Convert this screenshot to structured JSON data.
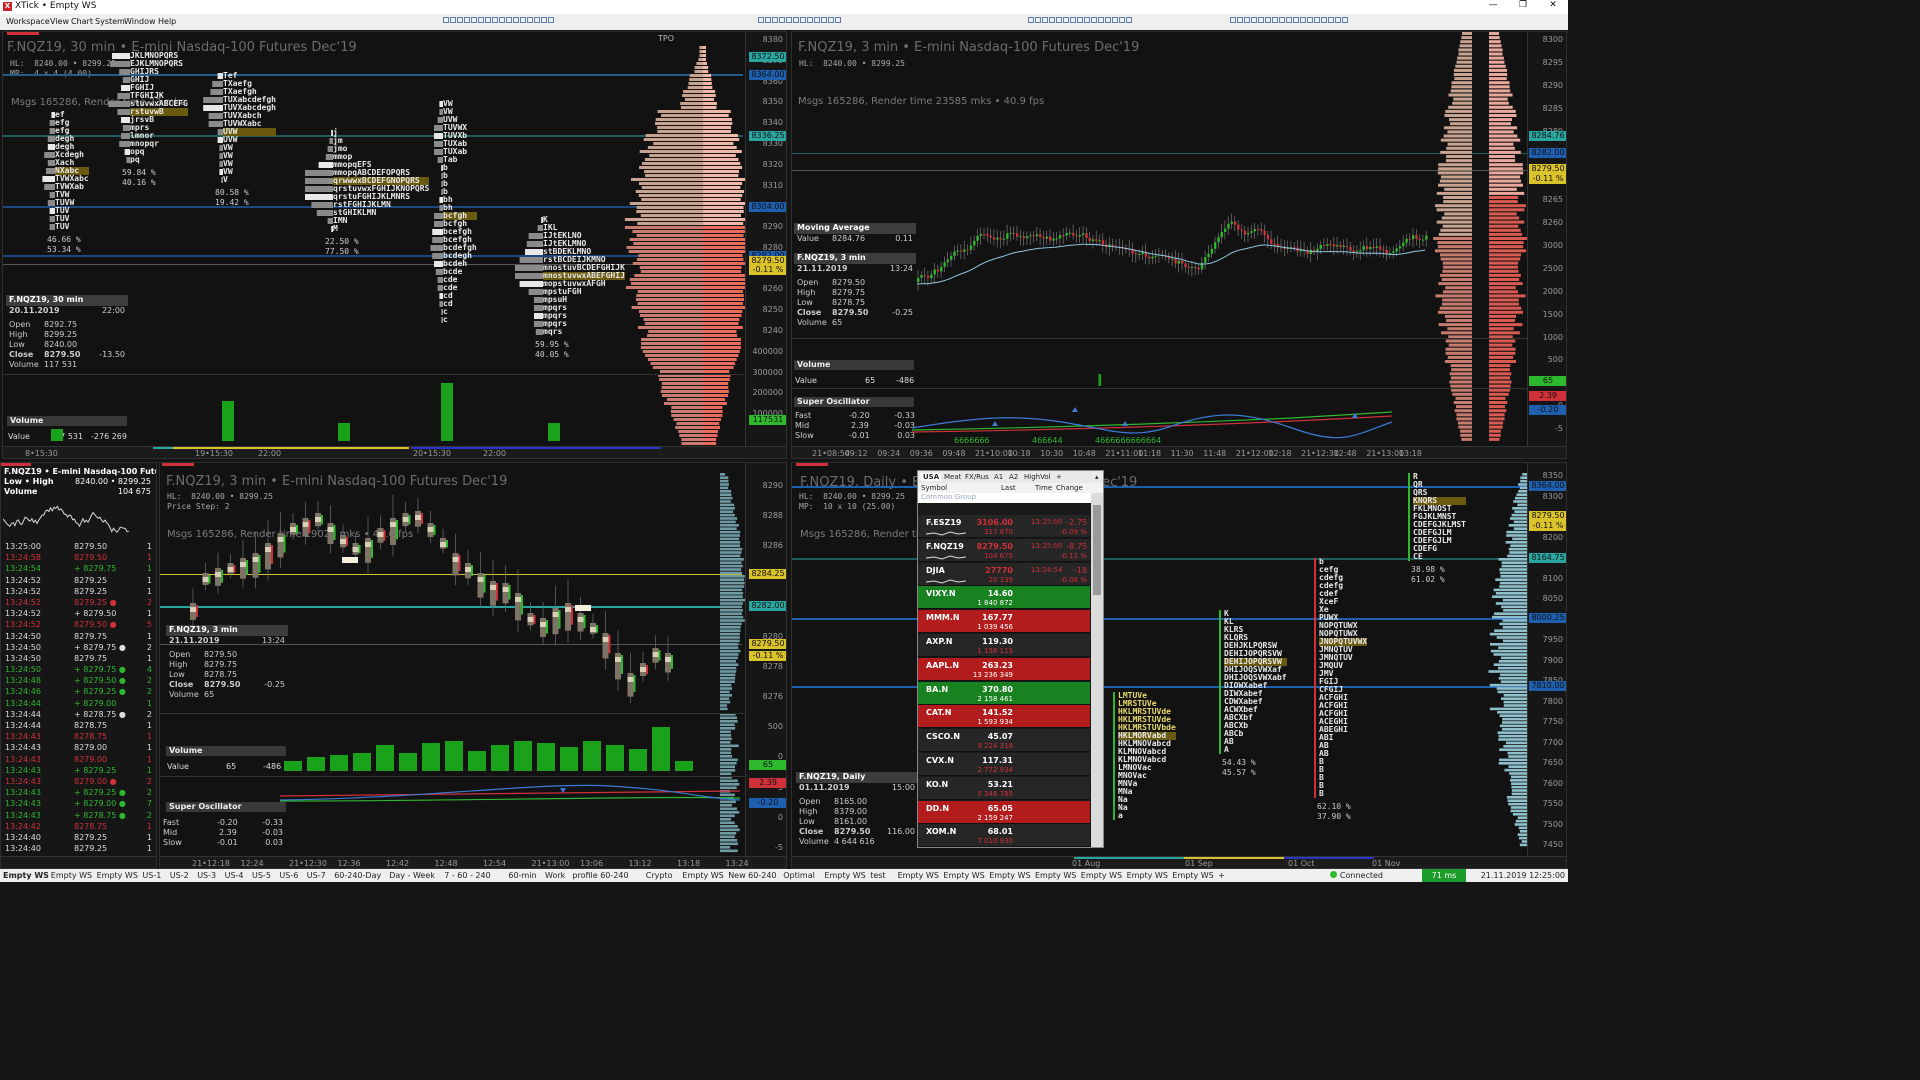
{
  "app": {
    "title": "XTick • Empty WS",
    "logo": "X",
    "window_controls": [
      "—",
      "❐",
      "✕"
    ]
  },
  "menu": [
    "Workspace",
    "View",
    "Chart",
    "System",
    "Window",
    "Help"
  ],
  "colors": {
    "bg": "#121212",
    "up": "#2eb82e",
    "down": "#d0303a",
    "blue": "#1f5fb0",
    "cyan": "#2aa6a0",
    "yellow": "#d9c22a",
    "salmon": "#e07a6e"
  },
  "pane_tl": {
    "title": "F.NQZ19, 30 min • E-mini Nasdaq-100 Futures Dec'19",
    "hl": "HL:  8240.00 • 8299.25",
    "mp": "MP:  4 x 4 (4.00)",
    "msgs": "Msgs 165286, Render time 23 mks",
    "tpo_label": "TPO",
    "axis": [
      "8380",
      "8370",
      "8360",
      "8350",
      "8340",
      "8330",
      "8320",
      "8310",
      "8300",
      "8290",
      "8280",
      "8270",
      "8260",
      "8250",
      "8240",
      "400000",
      "300000",
      "200000",
      "100000"
    ],
    "tags": [
      {
        "text": "8372.50",
        "c": "#2aa6a0"
      },
      {
        "text": "8364.00",
        "c": "#1f5fb0"
      },
      {
        "text": "8336.25",
        "c": "#2aa6a0"
      },
      {
        "text": "8304.00",
        "c": "#1f5fb0"
      },
      {
        "text": "8282.00",
        "c": "#1f5fb0"
      },
      {
        "text": "8279.50",
        "c": "#d9c22a"
      },
      {
        "text": "-0.11 %",
        "c": "#d9c22a"
      },
      {
        "text": "117531",
        "c": "#2eb82e"
      }
    ],
    "info": {
      "head": "F.NQZ19, 30 min",
      "date": "20.11.2019",
      "time": "22:00",
      "open": "8292.75",
      "high": "8299.25",
      "low": "8240.00",
      "close": "8279.50",
      "chg": "-13.50",
      "volume": "117 531"
    },
    "labels": {
      "open": "Open",
      "high": "High",
      "low": "Low",
      "close": "Close",
      "volume": "Volume"
    },
    "vol": {
      "title": "Volume",
      "label": "Value",
      "v1": "117 531",
      "v2": "-276 269"
    },
    "times": [
      "8•15:30",
      "19•15:30",
      "22:00",
      "20•15:30",
      "22:00"
    ],
    "profiles": [
      {
        "lines": [
          "ef",
          "efg",
          "efg",
          "degh",
          "degh",
          "Xcdegh",
          "Xach",
          "NXabc",
          "TVWXabc",
          "TVWXab",
          "TVW",
          "TUVW",
          "TUV",
          "TUV",
          "TUV"
        ],
        "p1": "46.66 %",
        "p2": "53.34 %"
      },
      {
        "lines": [
          "JKLMNOPQRS",
          "EJKLMNOPQRS",
          "GHIJRS",
          "GHIJ",
          "FGHIJ",
          "TFGHIJK",
          "stuvwxABCEFG",
          "rstuvwB",
          "jrsvB",
          "mprs",
          "lmnor",
          "mnopqr",
          "opq",
          "pq"
        ],
        "p1": "59.84 %",
        "p2": "40.16 %"
      },
      {
        "lines": [
          "Tef",
          "TXaefg",
          "TXaefgh",
          "TUXabcdefgh",
          "TUVXabcdegh",
          "TUVXabch",
          "TUVWXabc",
          "UVW",
          "UVW",
          "VW",
          "VW",
          "VW",
          "VW",
          "V"
        ],
        "p1": "80.58 %",
        "p2": "19.42 %"
      },
      {
        "lines": [
          "j",
          "jm",
          "jmo",
          "mmop",
          "mmopqEFS",
          "mmopqABCDEFOPQRS",
          "qrwwwxBCDEFGNOPQRS",
          "qrstuvwxFGHIJKNOPQRS",
          "qrstuFGHIJKLMNRS",
          "rstFGHIJKLMN",
          "stGHIKLMN",
          "IMN",
          "M"
        ],
        "p1": "22.50 %",
        "p2": "77.50 %"
      },
      {
        "lines": [
          "VW",
          "VW",
          "UVW",
          "TUVWX",
          "TUVXb",
          "TUXab",
          "TUXab",
          "Tab",
          "b",
          "b",
          "b",
          "b",
          "bh",
          "bh",
          "bcfgh",
          "bcfgh",
          "bcefgh",
          "bcefgh",
          "bcdefgh",
          "bcdegh",
          "bcdeh",
          "bcde",
          "cde",
          "cde",
          "cd",
          "cd",
          "c",
          "c"
        ],
        "p1": "",
        "p2": ""
      },
      {
        "lines": [
          "K",
          "IKL",
          "IJtEKLNO",
          "IJtEKLMNO",
          "stBDEKLMNO",
          "rstBCDEIJKMNO",
          "mnostuvBCDEFGHIJK",
          "mnostuvwxABEFGHIJ",
          "mopstuvwxAFGH",
          "mpstuFGH",
          "mpsuH",
          "mpqrs",
          "mpqrs",
          "mpqrs",
          "mqrs"
        ],
        "p1": "59.95 %",
        "p2": "40.05 %"
      }
    ]
  },
  "pane_tr": {
    "title": "F.NQZ19, 3 min • E-mini Nasdaq-100 Futures Dec'19",
    "hl": "HL:  8240.00 • 8299.25",
    "msgs": "Msgs 165286, Render time 23585 mks • 40.9 fps",
    "axis": [
      "8300",
      "8295",
      "8290",
      "8285",
      "8280",
      "8275",
      "8270",
      "8265",
      "8260",
      "3000",
      "2500",
      "2000",
      "1500",
      "1000",
      "500",
      "5",
      "0",
      "-5"
    ],
    "tags": [
      {
        "text": "8284.76",
        "c": "#2aa6a0"
      },
      {
        "text": "8282.00",
        "c": "#1f5fb0"
      },
      {
        "text": "8279.50",
        "c": "#d9c22a"
      },
      {
        "text": "-0.11 %",
        "c": "#d9c22a"
      },
      {
        "text": "65",
        "c": "#2eb82e"
      },
      {
        "text": "2.39",
        "c": "#d0303a"
      },
      {
        "text": "-0.20",
        "c": "#1f5fb0"
      }
    ],
    "ma": {
      "title": "Moving Average",
      "label": "Value",
      "v": "8284.76",
      "v2": "0.11"
    },
    "info": {
      "head": "F.NQZ19, 3 min",
      "date": "21.11.2019",
      "time": "13:24",
      "open": "8279.50",
      "high": "8279.75",
      "low": "8278.75",
      "close": "8279.50",
      "chg": "-0.25",
      "volume": "65"
    },
    "vol": {
      "title": "Volume",
      "label": "Value",
      "v1": "65",
      "v2": "-486"
    },
    "osc": {
      "title": "Super Oscillator",
      "fast": "Fast",
      "mid": "Mid",
      "slow": "Slow",
      "f1": "-0.20",
      "f2": "-0.33",
      "m1": "2.39",
      "m2": "-0.03",
      "s1": "-0.01",
      "s2": "0.03"
    },
    "osc_digits": [
      "6666666",
      "466644",
      "4666666666664"
    ],
    "times": [
      "21•08:54",
      "09:12",
      "09:24",
      "09:36",
      "09:48",
      "21•10:00",
      "10:18",
      "10:30",
      "10:48",
      "21•11:00",
      "11:18",
      "11:30",
      "11:48",
      "21•12:00",
      "12:18",
      "21•12:30",
      "12:48",
      "21•13:00",
      "13:18"
    ]
  },
  "ticks": {
    "head1": "F.NQZ19 • E-mini Nasdaq-100 Futures",
    "head2": "Low • High",
    "head2v": "8240.00 • 8299.25",
    "head3": "Volume",
    "head3v": "104 675",
    "rows": [
      {
        "t": "13:25:00",
        "p": "8279.50",
        "q": "1",
        "c": "#dddddd"
      },
      {
        "t": "13:24:58",
        "p": "8279.50",
        "q": "1",
        "c": "#d0303a"
      },
      {
        "t": "13:24:54",
        "p": "+ 8279.75",
        "q": "1",
        "c": "#2eb82e"
      },
      {
        "t": "13:24:52",
        "p": "8279.25",
        "q": "1",
        "c": "#dddddd"
      },
      {
        "t": "13:24:52",
        "p": "8279.25",
        "q": "1",
        "c": "#dddddd"
      },
      {
        "t": "13:24:52",
        "p": "8279.25 ●",
        "q": "2",
        "c": "#d0303a"
      },
      {
        "t": "13:24:52",
        "p": "+ 8279.50",
        "q": "1",
        "c": "#dddddd"
      },
      {
        "t": "13:24:52",
        "p": "8279.50 ●",
        "q": "5",
        "c": "#d0303a"
      },
      {
        "t": "13:24:50",
        "p": "8279.75",
        "q": "1",
        "c": "#dddddd"
      },
      {
        "t": "13:24:50",
        "p": "+ 8279.75 ●",
        "q": "2",
        "c": "#dddddd"
      },
      {
        "t": "13:24:50",
        "p": "8279.75",
        "q": "1",
        "c": "#dddddd"
      },
      {
        "t": "13:24:50",
        "p": "+ 8279.75 ●",
        "q": "4",
        "c": "#2eb82e"
      },
      {
        "t": "13:24:48",
        "p": "+ 8279.50 ●",
        "q": "2",
        "c": "#2eb82e"
      },
      {
        "t": "13:24:46",
        "p": "+ 8279.25 ●",
        "q": "2",
        "c": "#2eb82e"
      },
      {
        "t": "13:24:44",
        "p": "+ 8279.00",
        "q": "1",
        "c": "#2eb82e"
      },
      {
        "t": "13:24:44",
        "p": "+ 8278.75 ●",
        "q": "2",
        "c": "#dddddd"
      },
      {
        "t": "13:24:44",
        "p": "8278.75",
        "q": "1",
        "c": "#dddddd"
      },
      {
        "t": "13:24:43",
        "p": "8278.75",
        "q": "1",
        "c": "#d0303a"
      },
      {
        "t": "13:24:43",
        "p": "8279.00",
        "q": "1",
        "c": "#dddddd"
      },
      {
        "t": "13:24:43",
        "p": "8279.00",
        "q": "1",
        "c": "#d0303a"
      },
      {
        "t": "13:24:43",
        "p": "+ 8279.25",
        "q": "1",
        "c": "#2eb82e"
      },
      {
        "t": "13:24:43",
        "p": "8279.00 ●",
        "q": "2",
        "c": "#d0303a"
      },
      {
        "t": "13:24:43",
        "p": "+ 8279.25 ●",
        "q": "2",
        "c": "#2eb82e"
      },
      {
        "t": "13:24:43",
        "p": "+ 8279.00 ●",
        "q": "7",
        "c": "#2eb82e"
      },
      {
        "t": "13:24:43",
        "p": "+ 8278.75 ●",
        "q": "2",
        "c": "#2eb82e"
      },
      {
        "t": "13:24:42",
        "p": "8278.75",
        "q": "1",
        "c": "#d0303a"
      },
      {
        "t": "13:24:40",
        "p": "8279.25",
        "q": "1",
        "c": "#dddddd"
      },
      {
        "t": "13:24:40",
        "p": "8279.25",
        "q": "1",
        "c": "#dddddd"
      },
      {
        "t": "13:24:40",
        "p": "+ 8279.25",
        "q": "1",
        "c": "#d0303a"
      },
      {
        "t": "13:24:36",
        "p": "8279.50",
        "q": "1",
        "c": "#d0303a"
      },
      {
        "t": "13:24:34",
        "p": "8279.25",
        "q": "1",
        "c": "#dddddd"
      }
    ]
  },
  "pane_bm": {
    "title": "F.NQZ19, 3 min • E-mini Nasdaq-100 Futures Dec'19",
    "hl": "HL:  8240.00 • 8299.25",
    "step": "Price Step: 2",
    "msgs": "Msgs 165286, Render time 19029 mks • 43.6 fps",
    "axis": [
      "8290",
      "8288",
      "8286",
      "8284",
      "8282",
      "8280",
      "8278",
      "8276",
      "500",
      "0",
      "5",
      "0",
      "-5"
    ],
    "tags": [
      {
        "text": "8284.25",
        "c": "#d9c22a"
      },
      {
        "text": "8282.00",
        "c": "#2aa6a0"
      },
      {
        "text": "8279.50",
        "c": "#d9c22a"
      },
      {
        "text": "-0.11 %",
        "c": "#d9c22a"
      },
      {
        "text": "65",
        "c": "#2eb82e"
      },
      {
        "text": "2.39",
        "c": "#d0303a"
      },
      {
        "text": "-0.20",
        "c": "#1f5fb0"
      }
    ],
    "info": {
      "head": "F.NQZ19, 3 min",
      "date": "21.11.2019",
      "time": "13:24",
      "open": "8279.50",
      "high": "8279.75",
      "low": "8278.75",
      "close": "8279.50",
      "chg": "-0.25",
      "volume": "65"
    },
    "vol": {
      "title": "Volume",
      "label": "Value",
      "v1": "65",
      "v2": "-486"
    },
    "osc": {
      "title": "Super Oscillator",
      "fast": "Fast",
      "mid": "Mid",
      "slow": "Slow",
      "f1": "-0.20",
      "f2": "-0.33",
      "m1": "2.39",
      "m2": "-0.03",
      "s1": "-0.01",
      "s2": "0.03"
    },
    "times": [
      "21•12:18",
      "12:24",
      "21•12:30",
      "12:36",
      "12:42",
      "12:48",
      "12:54",
      "21•13:00",
      "13:06",
      "13:12",
      "13:18",
      "13:24"
    ]
  },
  "pane_br": {
    "title": "F.NQZ19, Daily • E-mini Nasdaq-100 Futures Dec'19",
    "hl": "HL:  8240.00 • 8299.25",
    "mp": "MP:  10 x 10 (25.00)",
    "msgs": "Msgs 165286, Render time",
    "axis": [
      "8350",
      "8300",
      "8250",
      "8200",
      "8150",
      "8100",
      "8050",
      "8000",
      "7950",
      "7900",
      "7850",
      "7800",
      "7750",
      "7700",
      "7650",
      "7600",
      "7550",
      "7500",
      "7450"
    ],
    "tags": [
      {
        "text": "8364.00",
        "c": "#1f5fb0"
      },
      {
        "text": "8279.50",
        "c": "#d9c22a"
      },
      {
        "text": "-0.11 %",
        "c": "#d9c22a"
      },
      {
        "text": "8164.75",
        "c": "#2aa6a0"
      },
      {
        "text": "8000.25",
        "c": "#1f5fb0"
      },
      {
        "text": "7810.00",
        "c": "#1f5fb0"
      }
    ],
    "info": {
      "head": "F.NQZ19, Daily",
      "date": "01.11.2019",
      "time": "15:00",
      "open": "8165.00",
      "high": "8379.00",
      "low": "8161.00",
      "close": "8279.50",
      "chg": "116.00",
      "volume": "4 644 616"
    },
    "times": [
      "01 Aug",
      "01 Sep",
      "01 Oct",
      "01 Nov"
    ],
    "profiles": [
      {
        "lines": [
          "LMTUVe",
          "LMRSTUVe",
          "HKLMRSTUVde",
          "HKLMRSTUVde",
          "HKLMRSTUVbde",
          "HKLMORVabd",
          "HKLMNOVabcd",
          "KLMNOVabcd",
          "KLMNOVabcd",
          "LMNOVac",
          "MNOVac",
          "MNVa",
          "MNa",
          "Na",
          "Na",
          "a"
        ],
        "p1": "",
        "p2": ""
      },
      {
        "lines": [
          "K",
          "KL",
          "KLRS",
          "KLQRS",
          "DEHJKLPQRSW",
          "DEHIJOPQRSVW",
          "DEHIJOPQRSVW",
          "DHIJOQSVWXaf",
          "DHIJOQSVWXabf",
          "DIOWXabef",
          "DIWXabef",
          "CDWXabef",
          "ACWXbef",
          "ABCXbf",
          "ABCXb",
          "ABCb",
          "AB",
          "A"
        ],
        "p1": "54.43 %",
        "p2": "45.57 %"
      },
      {
        "lines": [
          "b",
          "cefg",
          "cdefg",
          "cdefg",
          "cdef",
          "XceF",
          "Xe",
          "PUWX",
          "NOPQTUWX",
          "NOPQTUWX",
          "JNOPQTUVWX",
          "JMNQTUV",
          "JMNQTUV",
          "JMQUV",
          "JMV",
          "FGIJ",
          "CFGIJ",
          "ACFGHI",
          "ACFGHI",
          "ACFGHI",
          "ACEGHI",
          "ABEGHI",
          "ABI",
          "AB",
          "AB",
          "B",
          "B",
          "B",
          "B",
          "B"
        ],
        "p1": "62.10 %",
        "p2": "37.90 %"
      },
      {
        "lines": [
          "R",
          "QR",
          "QRS",
          "KNQRS",
          "FKLMNOST",
          "FGJKLMNST",
          "CDEFGJKLMST",
          "CDEFGJLM",
          "CDEFGJLM",
          "CDEFG",
          "CE"
        ],
        "p1": "38.98 %",
        "p2": "61.02 %"
      }
    ]
  },
  "watchlist": {
    "tabs": [
      "USA",
      "Meat",
      "FX/Rus",
      "A1",
      "A2",
      "HighVol",
      "+"
    ],
    "cols": [
      "Symbol",
      "Last",
      "Time",
      "Change"
    ],
    "group": "Common Group",
    "rows": [
      {
        "s": "F.ESZ19",
        "l1": "3106.00",
        "l2": "317 870",
        "t": "13:25:00",
        "c1": "-2.75",
        "c2": "-0.09 %",
        "bg": "#262626",
        "lc": "#d0303a"
      },
      {
        "s": "F.NQZ19",
        "l1": "8279.50",
        "l2": "104 675",
        "t": "13:25:00",
        "c1": "-8.75",
        "c2": "-0.11 %",
        "bg": "#262626",
        "lc": "#d0303a"
      },
      {
        "s": "DJIA",
        "l1": "27770",
        "l2": "20 339",
        "t": "13:24:54",
        "c1": "-18",
        "c2": "-0.06 %",
        "bg": "#262626",
        "lc": "#d0303a"
      },
      {
        "s": "VIXY.N",
        "l1": "14.60",
        "l2": "1 840 872",
        "t": "",
        "c1": "",
        "c2": "",
        "bg": "#17821f",
        "lc": "#ffffff"
      },
      {
        "s": "MMM.N",
        "l1": "167.77",
        "l2": "1 039 456",
        "t": "",
        "c1": "",
        "c2": "",
        "bg": "#b21c1c",
        "lc": "#ffffff"
      },
      {
        "s": "AXP.N",
        "l1": "119.30",
        "l2": "1 156 113",
        "t": "",
        "c1": "",
        "c2": "",
        "bg": "#262626",
        "lc": "#ffffff"
      },
      {
        "s": "AAPL.N",
        "l1": "263.23",
        "l2": "13 236 349",
        "t": "",
        "c1": "",
        "c2": "",
        "bg": "#b21c1c",
        "lc": "#ffffff"
      },
      {
        "s": "BA.N",
        "l1": "370.80",
        "l2": "2 158 461",
        "t": "",
        "c1": "",
        "c2": "",
        "bg": "#17821f",
        "lc": "#ffffff"
      },
      {
        "s": "CAT.N",
        "l1": "141.52",
        "l2": "1 593 934",
        "t": "",
        "c1": "",
        "c2": "",
        "bg": "#b21c1c",
        "lc": "#ffffff"
      },
      {
        "s": "CSCO.N",
        "l1": "45.07",
        "l2": "9 224 318",
        "t": "",
        "c1": "",
        "c2": "",
        "bg": "#262626",
        "lc": "#ffffff"
      },
      {
        "s": "CVX.N",
        "l1": "117.31",
        "l2": "2 772 934",
        "t": "",
        "c1": "",
        "c2": "",
        "bg": "#262626",
        "lc": "#ffffff"
      },
      {
        "s": "KO.N",
        "l1": "53.21",
        "l2": "5 346 789",
        "t": "",
        "c1": "",
        "c2": "",
        "bg": "#262626",
        "lc": "#ffffff"
      },
      {
        "s": "DD.N",
        "l1": "65.05",
        "l2": "2 159 247",
        "t": "",
        "c1": "",
        "c2": "",
        "bg": "#b21c1c",
        "lc": "#ffffff"
      },
      {
        "s": "XOM.N",
        "l1": "68.01",
        "l2": "7 010 930",
        "t": "",
        "c1": "",
        "c2": "",
        "bg": "#262626",
        "lc": "#ffffff"
      }
    ]
  },
  "workspace_tabs": [
    "Empty WS",
    "Empty WS",
    "Empty WS",
    "US-1",
    "US-2",
    "US-3",
    "US-4",
    "US-5",
    "US-6",
    "US-7",
    "60-240-Day",
    "Day - Week",
    "7 - 60 - 240",
    "60-min",
    "Work",
    "profile 60-240",
    "Crypto",
    "Empty WS",
    "New 60-240",
    "Optimal",
    "Empty WS",
    "test",
    "Empty WS",
    "Empty WS",
    "Empty WS",
    "Empty WS",
    "Empty WS",
    "Empty WS",
    "Empty WS",
    "+"
  ],
  "status": {
    "connected": "Connected",
    "latency": "71 ms",
    "clock": "21.11.2019 12:25:00"
  }
}
